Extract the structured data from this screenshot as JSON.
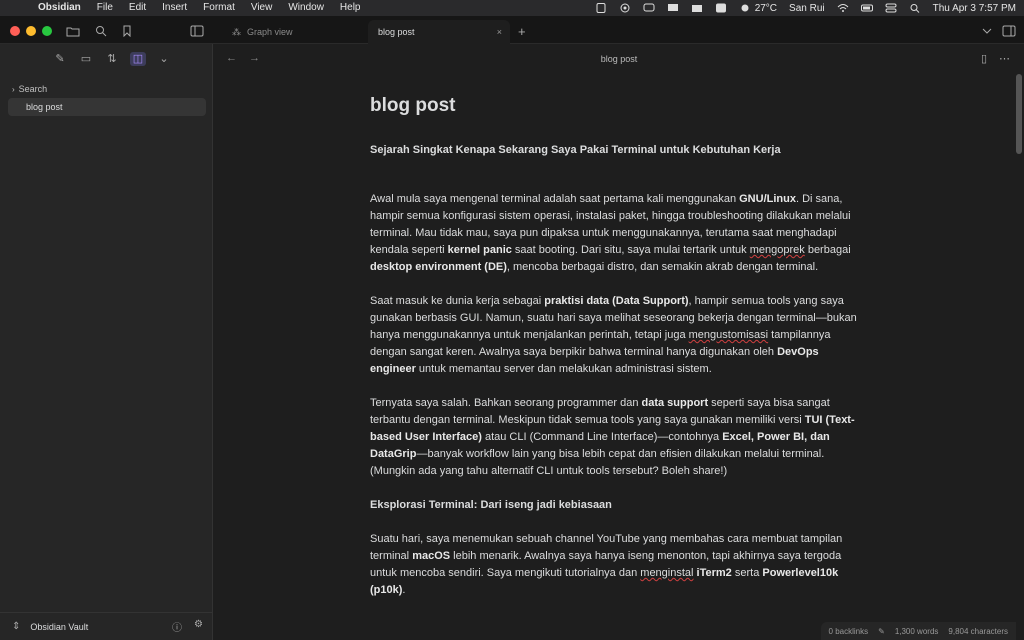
{
  "menubar": {
    "app_name": "Obsidian",
    "menus": [
      "File",
      "Edit",
      "Insert",
      "Format",
      "View",
      "Window",
      "Help"
    ],
    "weather": "27°C",
    "user": "San Rui",
    "datetime": "Thu Apr 3  7:57 PM"
  },
  "tabs": {
    "inactive_label": "Graph view",
    "active_label": "blog post",
    "close_symbol": "×",
    "new_tab_symbol": "+"
  },
  "sidebar": {
    "folder_label": "Search",
    "file_label": "blog post",
    "vault_name": "Obsidian Vault"
  },
  "editor": {
    "header_title": "blog post",
    "title": "blog post",
    "subtitle": "Sejarah Singkat Kenapa Sekarang Saya Pakai Terminal untuk Kebutuhan Kerja",
    "p1": [
      "Awal mula saya mengenal terminal adalah saat pertama kali menggunakan ",
      "GNU/Linux",
      ". Di sana, hampir semua konfigurasi sistem operasi, instalasi paket, hingga troubleshooting dilakukan melalui terminal. Mau tidak mau, saya pun dipaksa untuk menggunakannya, terutama saat menghadapi kendala seperti ",
      "kernel panic",
      " saat booting. Dari situ, saya mulai tertarik untuk ",
      "mengoprek",
      " berbagai ",
      "desktop environment (DE)",
      ", mencoba berbagai distro, dan semakin akrab dengan terminal."
    ],
    "p2": [
      "Saat masuk ke dunia kerja sebagai ",
      "praktisi data (Data Support)",
      ", hampir semua tools yang saya gunakan berbasis GUI. Namun, suatu hari saya melihat seseorang bekerja dengan terminal—bukan hanya menggunakannya untuk menjalankan perintah, tetapi juga ",
      "mengustomisasi",
      " tampilannya dengan sangat keren. Awalnya saya berpikir bahwa terminal hanya digunakan oleh ",
      "DevOps engineer",
      " untuk memantau server dan melakukan administrasi sistem."
    ],
    "p3": [
      "Ternyata saya salah. Bahkan seorang programmer dan ",
      "data support",
      " seperti saya bisa sangat terbantu dengan terminal. Meskipun tidak semua tools yang saya gunakan memiliki versi ",
      "TUI (Text-based User Interface)",
      " atau CLI (Command Line Interface)—contohnya ",
      "Excel, Power BI, dan DataGrip",
      "—banyak workflow lain yang bisa lebih cepat dan efisien dilakukan melalui terminal. (Mungkin ada yang tahu alternatif CLI untuk tools tersebut? Boleh share!)"
    ],
    "section2": "Eksplorasi Terminal: Dari iseng jadi kebiasaan",
    "p4": [
      "Suatu hari, saya menemukan sebuah channel YouTube yang membahas cara membuat tampilan terminal ",
      "macOS",
      " lebih menarik. Awalnya saya hanya iseng menonton, tapi akhirnya saya tergoda untuk mencoba sendiri. Saya mengikuti tutorialnya dan ",
      "menginstal",
      " ",
      "iTerm2",
      " serta ",
      "Powerlevel10k (p10k)",
      "."
    ]
  },
  "status": {
    "backlinks": "0 backlinks",
    "words": "1,300 words",
    "characters": "9,804 characters"
  }
}
